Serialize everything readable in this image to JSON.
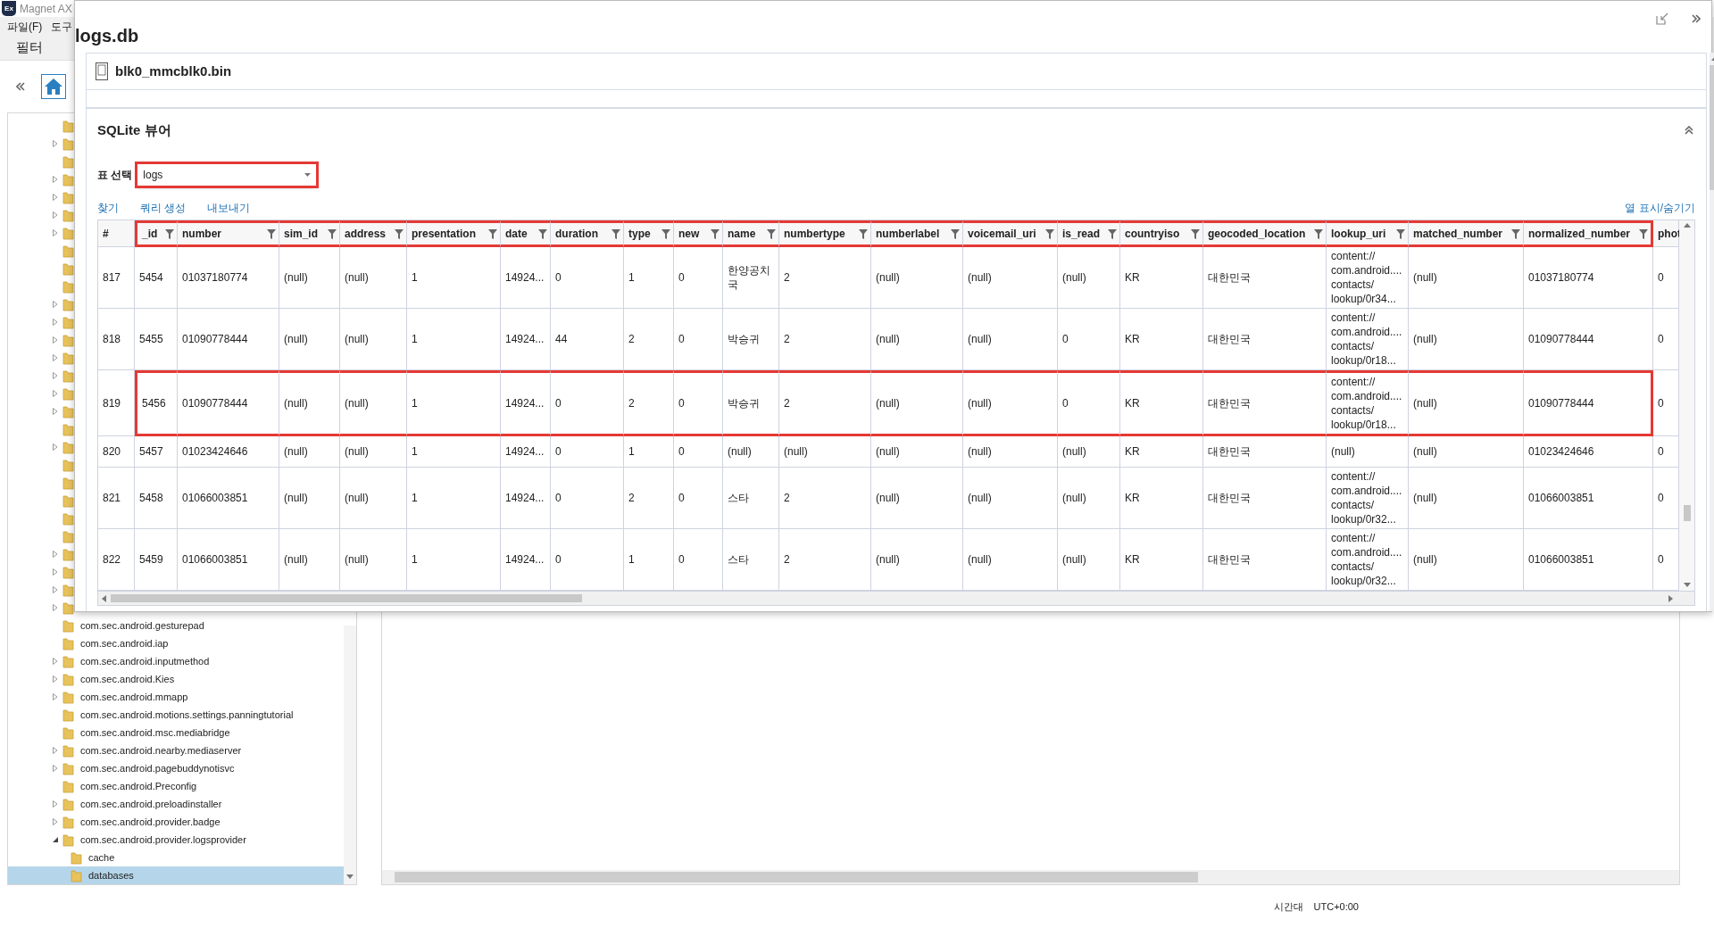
{
  "app": {
    "logo": "Ex",
    "title": "Magnet AX",
    "menu": [
      {
        "label": "파일(F)"
      },
      {
        "label": "도구"
      }
    ],
    "toolbar": [
      {
        "label": "필터"
      }
    ]
  },
  "tree": {
    "covered_rows": [
      {
        "expandable": false
      },
      {
        "expandable": true
      },
      {
        "expandable": false
      },
      {
        "expandable": true
      },
      {
        "expandable": true
      },
      {
        "expandable": true
      },
      {
        "expandable": true
      },
      {
        "expandable": false
      },
      {
        "expandable": false
      },
      {
        "expandable": false
      },
      {
        "expandable": true
      },
      {
        "expandable": true
      },
      {
        "expandable": true
      },
      {
        "expandable": true
      },
      {
        "expandable": true
      },
      {
        "expandable": true
      },
      {
        "expandable": true
      },
      {
        "expandable": false
      },
      {
        "expandable": true
      },
      {
        "expandable": false
      },
      {
        "expandable": false
      },
      {
        "expandable": false
      },
      {
        "expandable": false
      },
      {
        "expandable": false
      },
      {
        "expandable": true
      },
      {
        "expandable": true
      },
      {
        "expandable": true
      },
      {
        "expandable": true
      }
    ],
    "items": [
      {
        "label": "com.sec.android.gesturepad",
        "expandable": false,
        "selected": false
      },
      {
        "label": "com.sec.android.iap",
        "expandable": false,
        "selected": false
      },
      {
        "label": "com.sec.android.inputmethod",
        "expandable": true,
        "expanded": false,
        "selected": false
      },
      {
        "label": "com.sec.android.Kies",
        "expandable": true,
        "expanded": false,
        "selected": false
      },
      {
        "label": "com.sec.android.mmapp",
        "expandable": true,
        "expanded": false,
        "selected": false
      },
      {
        "label": "com.sec.android.motions.settings.panningtutorial",
        "expandable": false,
        "selected": false
      },
      {
        "label": "com.sec.android.msc.mediabridge",
        "expandable": false,
        "selected": false
      },
      {
        "label": "com.sec.android.nearby.mediaserver",
        "expandable": true,
        "expanded": false,
        "selected": false
      },
      {
        "label": "com.sec.android.pagebuddynotisvc",
        "expandable": true,
        "expanded": false,
        "selected": false
      },
      {
        "label": "com.sec.android.Preconfig",
        "expandable": false,
        "selected": false
      },
      {
        "label": "com.sec.android.preloadinstaller",
        "expandable": true,
        "expanded": false,
        "selected": false
      },
      {
        "label": "com.sec.android.provider.badge",
        "expandable": true,
        "expanded": false,
        "selected": false
      },
      {
        "label": "com.sec.android.provider.logsprovider",
        "expandable": true,
        "expanded": true,
        "selected": false,
        "children": [
          {
            "label": "cache",
            "selected": false
          },
          {
            "label": "databases",
            "selected": true
          }
        ]
      }
    ]
  },
  "status_bar": {
    "label": "시간대",
    "value": "UTC+0:00"
  },
  "panel": {
    "title": "logs.db",
    "source": "blk0_mmcblk0.bin",
    "section_title": "SQLite 뷰어",
    "table_select": {
      "label": "표 선택",
      "value": "logs",
      "highlighted": true
    },
    "actions": [
      "찾기",
      "쿼리 생성",
      "내보내기"
    ],
    "column_toggle": "열 표시/숨기기",
    "table": {
      "columns": [
        {
          "label": "#",
          "filter": false,
          "highlighted": false
        },
        {
          "label": "_id",
          "filter": true,
          "highlighted": true
        },
        {
          "label": "number",
          "filter": true,
          "highlighted": true
        },
        {
          "label": "sim_id",
          "filter": true,
          "highlighted": true
        },
        {
          "label": "address",
          "filter": true,
          "highlighted": true
        },
        {
          "label": "presentation",
          "filter": true,
          "highlighted": true
        },
        {
          "label": "date",
          "filter": true,
          "highlighted": true
        },
        {
          "label": "duration",
          "filter": true,
          "highlighted": true
        },
        {
          "label": "type",
          "filter": true,
          "highlighted": true
        },
        {
          "label": "new",
          "filter": true,
          "highlighted": true
        },
        {
          "label": "name",
          "filter": true,
          "highlighted": true
        },
        {
          "label": "numbertype",
          "filter": true,
          "highlighted": true
        },
        {
          "label": "numberlabel",
          "filter": true,
          "highlighted": true
        },
        {
          "label": "voicemail_uri",
          "filter": true,
          "highlighted": true
        },
        {
          "label": "is_read",
          "filter": true,
          "highlighted": true
        },
        {
          "label": "countryiso",
          "filter": true,
          "highlighted": true
        },
        {
          "label": "geocoded_location",
          "filter": true,
          "highlighted": true
        },
        {
          "label": "lookup_uri",
          "filter": true,
          "highlighted": true
        },
        {
          "label": "matched_number",
          "filter": true,
          "highlighted": true
        },
        {
          "label": "normalized_number",
          "filter": true,
          "highlighted": true
        },
        {
          "label": "phot",
          "filter": false,
          "highlighted": false
        }
      ],
      "rows": [
        {
          "highlighted": false,
          "cells": [
            "817",
            "5454",
            "01037180774",
            "(null)",
            "(null)",
            "1",
            "14924...",
            "0",
            "1",
            "0",
            "한양공치국",
            "2",
            "(null)",
            "(null)",
            "(null)",
            "KR",
            "대한민국",
            "content://\ncom.android....\ncontacts/\nlookup/0r34...",
            "(null)",
            "01037180774",
            "0"
          ]
        },
        {
          "highlighted": false,
          "cells": [
            "818",
            "5455",
            "01090778444",
            "(null)",
            "(null)",
            "1",
            "14924...",
            "44",
            "2",
            "0",
            "박승귀",
            "2",
            "(null)",
            "(null)",
            "0",
            "KR",
            "대한민국",
            "content://\ncom.android....\ncontacts/\nlookup/0r18...",
            "(null)",
            "01090778444",
            "0"
          ]
        },
        {
          "highlighted": true,
          "cells": [
            "819",
            "5456",
            "01090778444",
            "(null)",
            "(null)",
            "1",
            "14924...",
            "0",
            "2",
            "0",
            "박승귀",
            "2",
            "(null)",
            "(null)",
            "0",
            "KR",
            "대한민국",
            "content://\ncom.android....\ncontacts/\nlookup/0r18...",
            "(null)",
            "01090778444",
            "0"
          ]
        },
        {
          "highlighted": false,
          "cells": [
            "820",
            "5457",
            "01023424646",
            "(null)",
            "(null)",
            "1",
            "14924...",
            "0",
            "1",
            "0",
            "(null)",
            "(null)",
            "(null)",
            "(null)",
            "(null)",
            "KR",
            "대한민국",
            "(null)",
            "(null)",
            "01023424646",
            "0"
          ]
        },
        {
          "highlighted": false,
          "cells": [
            "821",
            "5458",
            "01066003851",
            "(null)",
            "(null)",
            "1",
            "14924...",
            "0",
            "2",
            "0",
            "스타",
            "2",
            "(null)",
            "(null)",
            "(null)",
            "KR",
            "대한민국",
            "content://\ncom.android....\ncontacts/\nlookup/0r32...",
            "(null)",
            "01066003851",
            "0"
          ]
        },
        {
          "highlighted": false,
          "cells": [
            "822",
            "5459",
            "01066003851",
            "(null)",
            "(null)",
            "1",
            "14924...",
            "0",
            "1",
            "0",
            "스타",
            "2",
            "(null)",
            "(null)",
            "(null)",
            "KR",
            "대한민국",
            "content://\ncom.android....\ncontacts/\nlookup/0r32...",
            "(null)",
            "01066003851",
            "0"
          ]
        }
      ]
    }
  }
}
